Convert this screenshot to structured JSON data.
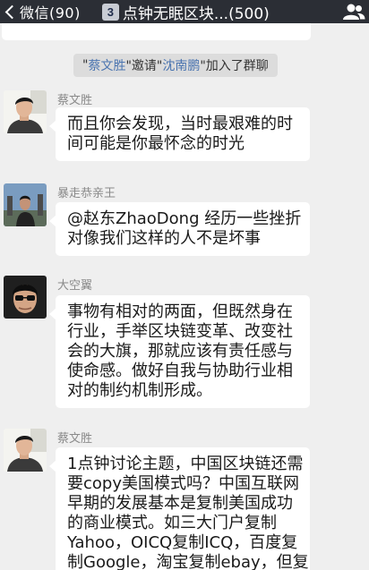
{
  "topbar": {
    "back_label": "微信(90)",
    "title_badge": "3",
    "title": "点钟无眠区块...(500)"
  },
  "system_note": {
    "quote_open": "\"",
    "inviter": "蔡文胜",
    "middle": "\"邀请\"",
    "invitee": "沈南鹏",
    "suffix": "\"加入了群聊"
  },
  "messages": [
    {
      "sender": "蔡文胜",
      "lines": [
        "而且你会发现，当时最艰难的时",
        "间可能是你最怀念的时光"
      ]
    },
    {
      "sender": "暴走恭亲王",
      "lines": [
        "@赵东ZhaoDong 经历一些挫折",
        "对像我们这样的人不是坏事"
      ]
    },
    {
      "sender": "大空翼",
      "lines": [
        "事物有相对的两面，但既然身在",
        "行业，手举区块链变革、改变社",
        "会的大旗，那就应该有责任感与",
        "使命感。做好自我与协助行业相",
        "对的制约机制形成。"
      ]
    },
    {
      "sender": "蔡文胜",
      "lines": [
        "1点钟讨论主题，中国区块链还需",
        "要copy美国模式吗？中国互联网",
        "早期的发展基本是复制美国成功",
        "的商业模式。如三大门户复制",
        "Yahoo，OICQ复制ICQ，百度复",
        "制Google，淘宝复制ebay，但复"
      ]
    }
  ]
}
